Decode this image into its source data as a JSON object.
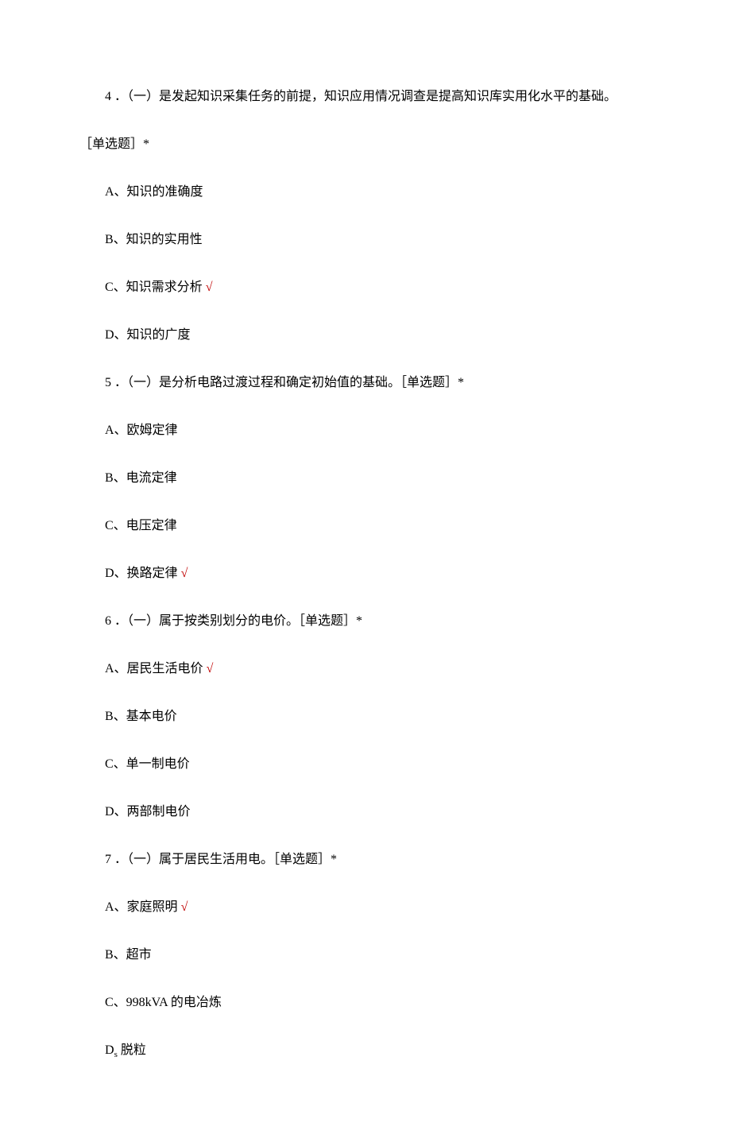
{
  "q4": {
    "line1": "4 ．（一）是发起知识采集任务的前提，知识应用情况调查是提高知识库实用化水平的基础。",
    "line2": "［单选题］*",
    "a": "A、知识的准确度",
    "b": "B、知识的实用性",
    "c": "C、知识需求分析",
    "c_check": " √",
    "d": "D、知识的广度"
  },
  "q5": {
    "text": "5 ．（一）是分析电路过渡过程和确定初始值的基础。［单选题］*",
    "a": "A、欧姆定律",
    "b": "B、电流定律",
    "c": "C、电压定律",
    "d": "D、换路定律",
    "d_check": " √"
  },
  "q6": {
    "text": "6 ．（一）属于按类别划分的电价。［单选题］*",
    "a": "A、居民生活电价",
    "a_check": " √",
    "b": "B、基本电价",
    "c": "C、单一制电价",
    "d": "D、两部制电价"
  },
  "q7": {
    "text": "7 ．（一）属于居民生活用电。［单选题］*",
    "a": "A、家庭照明",
    "a_check": " √",
    "b": "B、超市",
    "c": "C、998kVA 的电冶炼",
    "d_prefix": "D",
    "d_sub": "s",
    "d_suffix": " 脱粒"
  }
}
